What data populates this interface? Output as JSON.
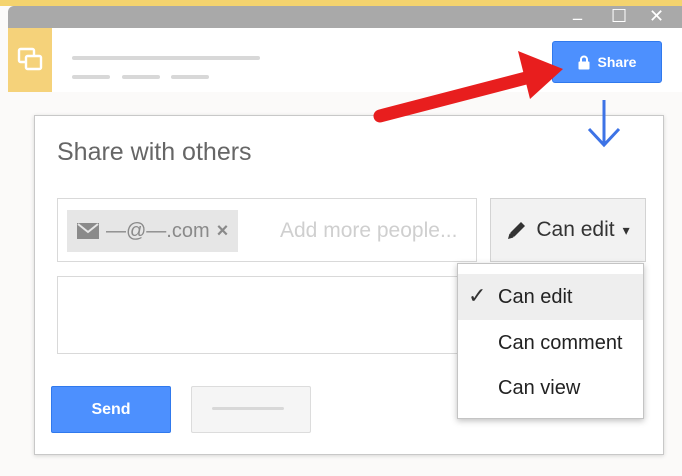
{
  "window": {
    "minimize_glyph": "_",
    "maximize_glyph": "☐",
    "close_glyph": "✕"
  },
  "header": {
    "share_button_label": "Share",
    "share_icon": "lock-icon",
    "app_icon": "slides-icon"
  },
  "dialog": {
    "title": "Share with others",
    "recipient_chip": {
      "icon": "envelope-icon",
      "text": "—@—.com",
      "remove_glyph": "×"
    },
    "people_placeholder": "Add more people...",
    "permission_button": {
      "icon": "pencil-icon",
      "label": "Can edit",
      "caret_glyph": "▾"
    },
    "send_label": "Send",
    "permission_menu": {
      "items": [
        {
          "label": "Can edit",
          "selected": true
        },
        {
          "label": "Can comment",
          "selected": false
        },
        {
          "label": "Can view",
          "selected": false
        }
      ],
      "check_glyph": "✓"
    }
  },
  "annotations": {
    "red_arrow_color": "#e81e1e",
    "blue_arrow_color": "#3d73e6"
  },
  "colors": {
    "accent_blue": "#4d90fe",
    "app_tile": "#f5d27a",
    "titlebar": "#a9a9a9"
  }
}
